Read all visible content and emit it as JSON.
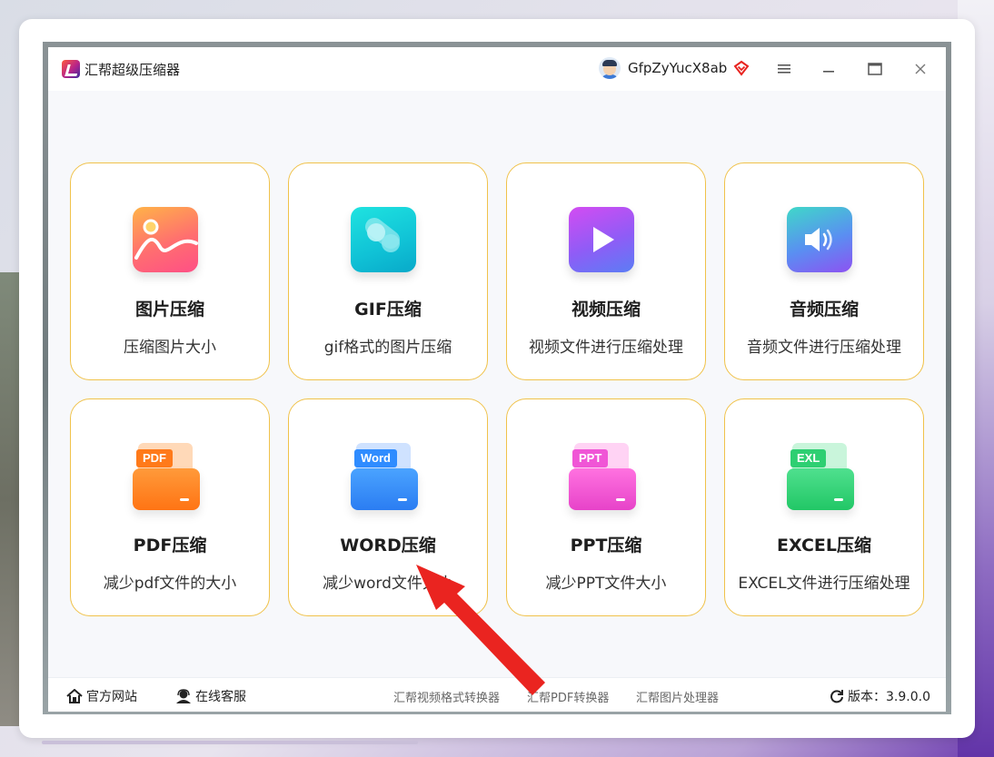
{
  "app": {
    "title": "汇帮超级压缩器",
    "username": "GfpZyYucX8ab"
  },
  "titlebar_buttons": {
    "menu_icon": "hamburger-menu-icon",
    "minimize_icon": "minimize-icon",
    "maximize_icon": "maximize-icon",
    "close_icon": "close-icon"
  },
  "cards": [
    {
      "title": "图片压缩",
      "desc": "压缩图片大小",
      "icon": "image-icon",
      "color": "#ff6b7a"
    },
    {
      "title": "GIF压缩",
      "desc": "gif格式的图片压缩",
      "icon": "gif-icon",
      "color": "#16c7d8"
    },
    {
      "title": "视频压缩",
      "desc": "视频文件进行压缩处理",
      "icon": "video-play-icon",
      "color": "#8a5cf6"
    },
    {
      "title": "音频压缩",
      "desc": "音频文件进行压缩处理",
      "icon": "audio-speaker-icon",
      "color": "#6f6cf0"
    },
    {
      "title": "PDF压缩",
      "desc": "减少pdf文件的大小",
      "icon": "pdf-folder-icon",
      "tag": "PDF",
      "color": "#ff7a1a"
    },
    {
      "title": "WORD压缩",
      "desc": "减少word文件大小",
      "icon": "word-folder-icon",
      "tag": "Word",
      "color": "#2f8cff"
    },
    {
      "title": "PPT压缩",
      "desc": "减少PPT文件大小",
      "icon": "ppt-folder-icon",
      "tag": "PPT",
      "color": "#f055d6"
    },
    {
      "title": "EXCEL压缩",
      "desc": "EXCEL文件进行压缩处理",
      "icon": "excel-folder-icon",
      "tag": "EXL",
      "color": "#2ecf72"
    }
  ],
  "footer": {
    "website": "官方网站",
    "support": "在线客服",
    "links": [
      "汇帮视频格式转换器",
      "汇帮PDF转换器",
      "汇帮图片处理器"
    ],
    "version": "版本：3.9.0.0"
  },
  "colors": {
    "card_border": "#f0c24a",
    "arrow": "#e8231f"
  }
}
